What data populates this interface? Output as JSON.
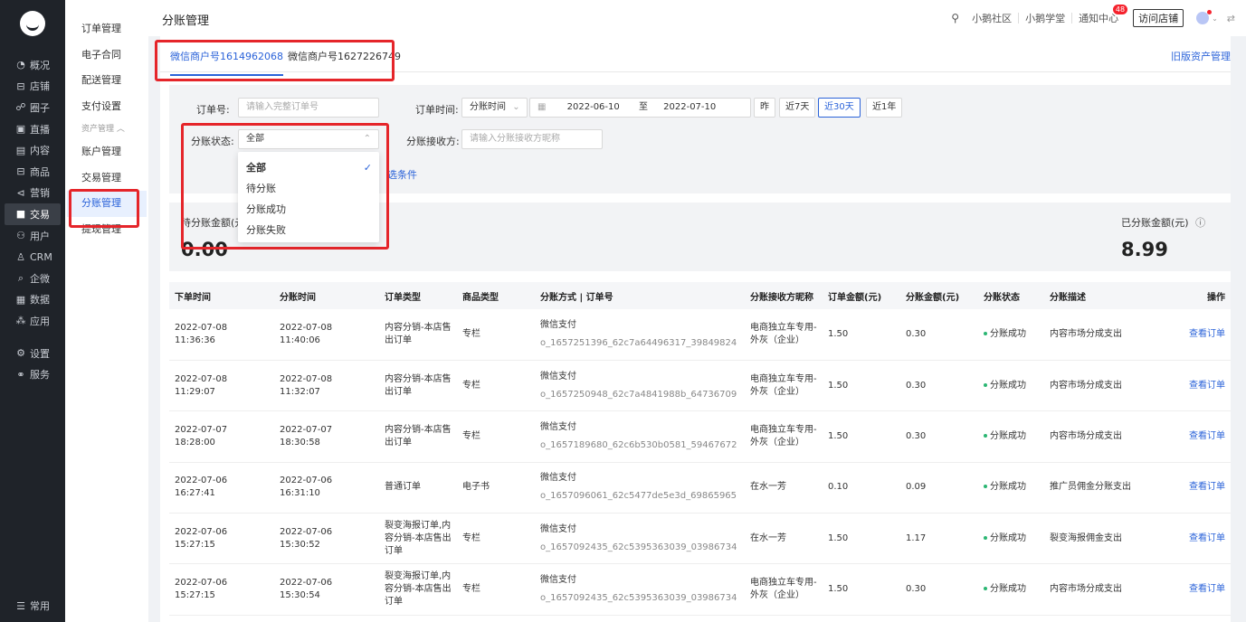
{
  "nav": {
    "items": [
      {
        "icon": "◔",
        "label": "概况"
      },
      {
        "icon": "⊟",
        "label": "店铺"
      },
      {
        "icon": "☍",
        "label": "圈子"
      },
      {
        "icon": "▣",
        "label": "直播"
      },
      {
        "icon": "▤",
        "label": "内容"
      },
      {
        "icon": "⊟",
        "label": "商品"
      },
      {
        "icon": "⊲",
        "label": "营销"
      },
      {
        "icon": "■",
        "label": "交易"
      },
      {
        "icon": "⚇",
        "label": "用户"
      },
      {
        "icon": "♙",
        "label": "CRM"
      },
      {
        "icon": "⌕",
        "label": "企微"
      },
      {
        "icon": "▦",
        "label": "数据"
      },
      {
        "icon": "⁂",
        "label": "应用"
      }
    ],
    "lower": [
      {
        "icon": "⚙",
        "label": "设置"
      },
      {
        "icon": "⚭",
        "label": "服务"
      }
    ],
    "bottom": {
      "icon": "☰",
      "label": "常用"
    }
  },
  "subnav": {
    "items_top": [
      "订单管理",
      "电子合同",
      "配送管理",
      "支付设置"
    ],
    "group": "资产管理 ︿",
    "items_group": [
      "账户管理",
      "交易管理",
      "分账管理",
      "提现管理"
    ]
  },
  "header": {
    "title": "分账管理",
    "community": "小鹅社区",
    "academy": "小鹅学堂",
    "notice": "通知中心",
    "notice_count": "48",
    "visit": "访问店铺"
  },
  "tabs": {
    "tab1": "微信商户号1614962068",
    "tab2": "微信商户号1627226749",
    "old_link": "旧版资产管理"
  },
  "filters": {
    "order_no_label": "订单号:",
    "order_no_placeholder": "请输入完整订单号",
    "order_time_label": "订单时间:",
    "time_type": "分账时间",
    "date_start": "2022-06-10",
    "date_to": "至",
    "date_end": "2022-07-10",
    "quick": [
      "昨",
      "近7天",
      "近30天",
      "近1年"
    ],
    "status_label": "分账状态:",
    "status_value": "全部",
    "receiver_label": "分账接收方:",
    "receiver_placeholder": "请输入分账接收方昵称",
    "more": "选条件"
  },
  "dropdown": {
    "options": [
      "全部",
      "待分账",
      "分账成功",
      "分账失败"
    ]
  },
  "summary": {
    "pending_label": "待分账金额(元",
    "pending_value": "0.00",
    "done_label": "已分账金额(元)",
    "done_value": "8.99"
  },
  "table": {
    "headers": [
      "下单时间",
      "分账时间",
      "订单类型",
      "商品类型",
      "分账方式 | 订单号",
      "分账接收方昵称",
      "订单金额(元)",
      "分账金额(元)",
      "分账状态",
      "分账描述",
      "操作"
    ],
    "rows": [
      {
        "order_time": "2022-07-08 11:36:36",
        "split_time": "2022-07-08 11:40:06",
        "order_type": "内容分销-本店售出订单",
        "goods_type": "专栏",
        "pay": "微信支付",
        "order_no": "o_1657251396_62c7a64496317_39849824",
        "receiver": "电商独立车专用-外灰（企业）",
        "amount": "1.50",
        "split_amount": "0.30",
        "status": "分账成功",
        "desc": "内容市场分成支出",
        "action": "查看订单"
      },
      {
        "order_time": "2022-07-08 11:29:07",
        "split_time": "2022-07-08 11:32:07",
        "order_type": "内容分销-本店售出订单",
        "goods_type": "专栏",
        "pay": "微信支付",
        "order_no": "o_1657250948_62c7a4841988b_64736709",
        "receiver": "电商独立车专用-外灰（企业）",
        "amount": "1.50",
        "split_amount": "0.30",
        "status": "分账成功",
        "desc": "内容市场分成支出",
        "action": "查看订单"
      },
      {
        "order_time": "2022-07-07 18:28:00",
        "split_time": "2022-07-07 18:30:58",
        "order_type": "内容分销-本店售出订单",
        "goods_type": "专栏",
        "pay": "微信支付",
        "order_no": "o_1657189680_62c6b530b0581_59467672",
        "receiver": "电商独立车专用-外灰（企业）",
        "amount": "1.50",
        "split_amount": "0.30",
        "status": "分账成功",
        "desc": "内容市场分成支出",
        "action": "查看订单"
      },
      {
        "order_time": "2022-07-06 16:27:41",
        "split_time": "2022-07-06 16:31:10",
        "order_type": "普通订单",
        "goods_type": "电子书",
        "pay": "微信支付",
        "order_no": "o_1657096061_62c5477de5e3d_69865965",
        "receiver": "在水一芳",
        "amount": "0.10",
        "split_amount": "0.09",
        "status": "分账成功",
        "desc": "推广员佣金分账支出",
        "action": "查看订单"
      },
      {
        "order_time": "2022-07-06 15:27:15",
        "split_time": "2022-07-06 15:30:52",
        "order_type": "裂变海报订单,内容分销-本店售出订单",
        "goods_type": "专栏",
        "pay": "微信支付",
        "order_no": "o_1657092435_62c5395363039_03986734",
        "receiver": "在水一芳",
        "amount": "1.50",
        "split_amount": "1.17",
        "status": "分账成功",
        "desc": "裂变海报佣金支出",
        "action": "查看订单"
      },
      {
        "order_time": "2022-07-06 15:27:15",
        "split_time": "2022-07-06 15:30:54",
        "order_type": "裂变海报订单,内容分销-本店售出订单",
        "goods_type": "专栏",
        "pay": "微信支付",
        "order_no": "o_1657092435_62c5395363039_03986734",
        "receiver": "电商独立车专用-外灰（企业）",
        "amount": "1.50",
        "split_amount": "0.30",
        "status": "分账成功",
        "desc": "内容市场分成支出",
        "action": "查看订单"
      }
    ]
  },
  "colors": {
    "accent": "#2b63d9",
    "highlight_box": "#e5252a",
    "nav_bg": "#1f2329",
    "success": "#2bb673"
  }
}
